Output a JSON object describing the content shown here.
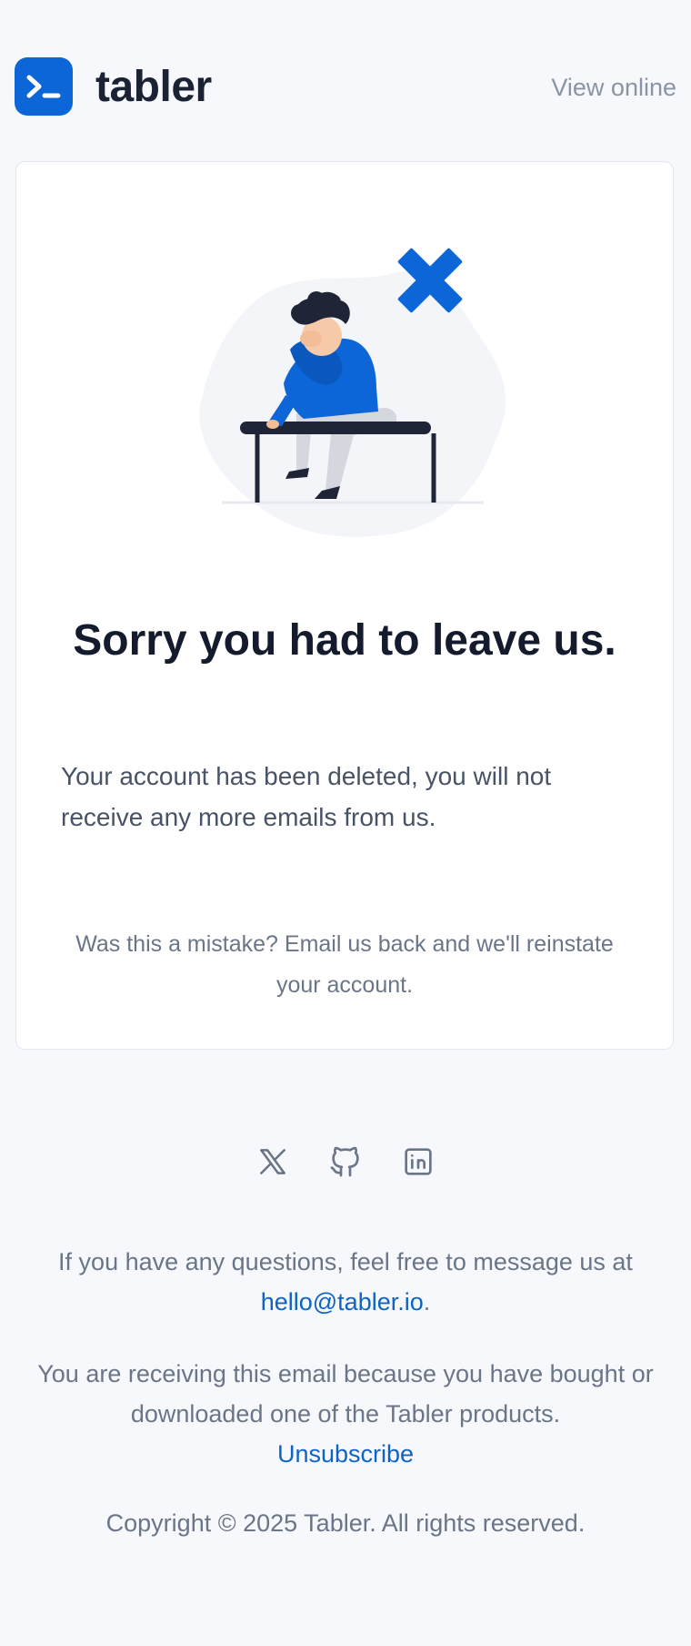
{
  "brand": {
    "name": "tabler",
    "logo_color": "#0c66d8"
  },
  "header": {
    "view_online_label": "View online"
  },
  "card": {
    "title": "Sorry you had to leave us.",
    "message": "Your account has been deleted, you will not receive any more emails from us.",
    "note": "Was this a mistake? Email us back and we'll reinstate your account."
  },
  "social": {
    "icons": [
      "x-icon",
      "github-icon",
      "linkedin-icon"
    ]
  },
  "footer": {
    "questions_text": "If you have any questions, feel free to message us at",
    "email": "hello@tabler.io",
    "email_suffix": ".",
    "receiving_text": "You are receiving this email because you have bought or downloaded one of the Tabler products.",
    "unsubscribe_label": "Unsubscribe",
    "copyright": "Copyright © 2025 Tabler. All rights reserved."
  },
  "colors": {
    "accent": "#0c66d8",
    "link": "#0e63c4",
    "background": "#f6f8fb"
  }
}
